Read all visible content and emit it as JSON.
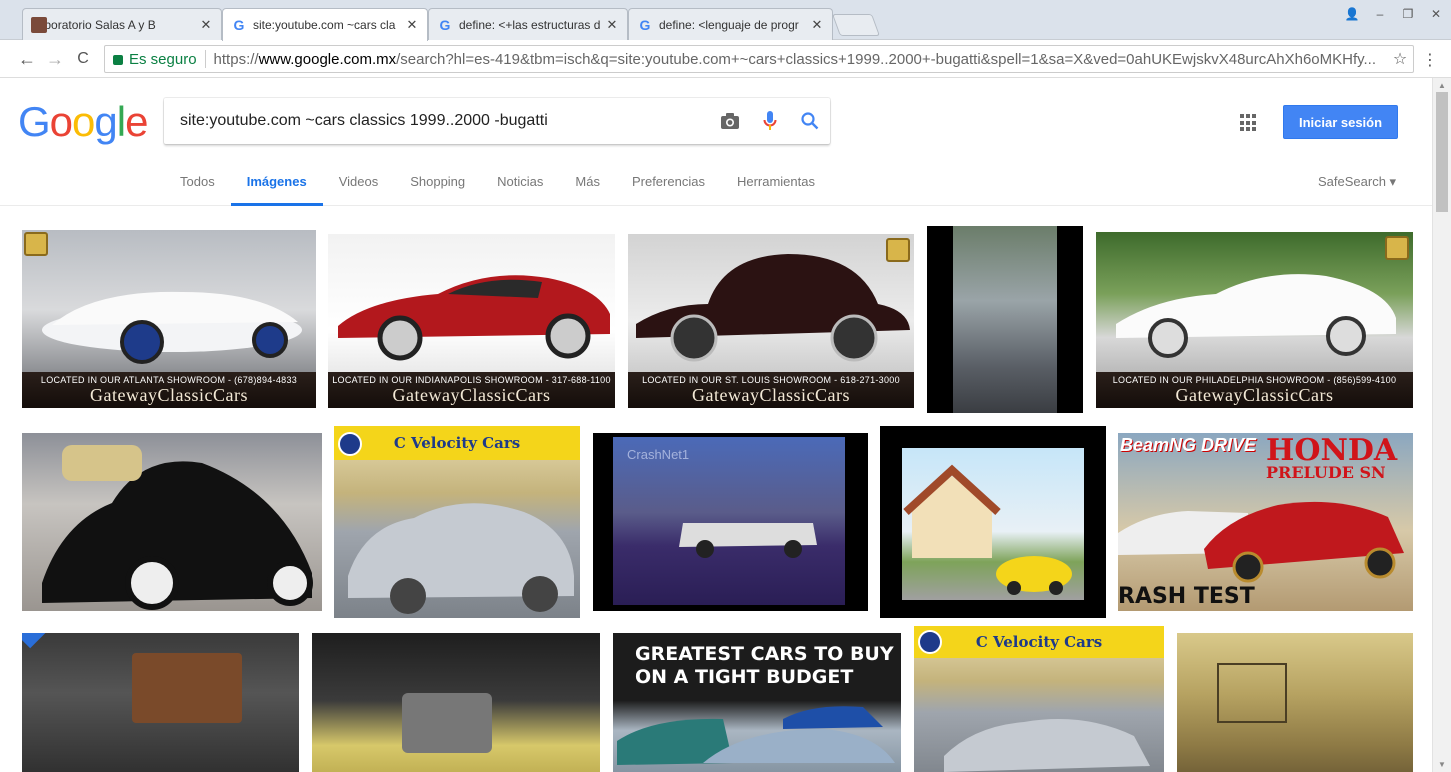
{
  "browser": {
    "tabs": [
      {
        "title": "Laboratorio Salas A y B",
        "favicon": "lab-image-icon"
      },
      {
        "title": "site:youtube.com ~cars cla",
        "favicon": "google-icon",
        "active": true
      },
      {
        "title": "define: <+las estructuras d",
        "favicon": "google-icon"
      },
      {
        "title": "define: <lenguaje de progr",
        "favicon": "google-icon"
      }
    ],
    "close_glyph": "✕",
    "window_controls": {
      "profile": "👤",
      "minimize": "–",
      "maximize": "❐",
      "close": "✕"
    },
    "nav": {
      "back": "←",
      "forward": "→",
      "reload": "C"
    },
    "secure_label": "Es seguro",
    "url_scheme": "https://",
    "url_host": "www.google.com.mx",
    "url_rest": "/search?hl=es-419&tbm=isch&q=site:youtube.com+~cars+classics+1999..2000+-bugatti&spell=1&sa=X&ved=0ahUKEwjskvX48urcAhXh6oMKHfy...",
    "star": "☆",
    "menu": "⋮"
  },
  "google": {
    "logo_letters": [
      "G",
      "o",
      "o",
      "g",
      "l",
      "e"
    ],
    "query": "site:youtube.com ~cars classics 1999..2000 -bugatti",
    "signin": "Iniciar sesión",
    "tabs": [
      "Todos",
      "Imágenes",
      "Videos",
      "Shopping",
      "Noticias",
      "Más",
      "Preferencias",
      "Herramientas"
    ],
    "active_tab": "Imágenes",
    "safesearch": "SafeSearch ▾"
  },
  "images": {
    "gateway_brand": "GatewayClassicCars",
    "located": "LOCATED IN OUR",
    "gateway_captions": [
      "ATLANTA SHOWROOM - (678)894-4833",
      "INDIANAPOLIS SHOWROOM - 317-688-1100",
      "ST. LOUIS SHOWROOM - 618-271-3000",
      "PHILADELPHIA SHOWROOM - (856)599-4100"
    ],
    "velocity": "C Velocity Cars",
    "crashnet": "CrashNet1",
    "beamng_left": "BeamNG DRIVE",
    "honda_title": "HONDA",
    "honda_sub": "PRELUDE SN",
    "crash_test": "RASH TEST",
    "budget_headline": "GREATEST CARS TO BUY ON A TIGHT BUDGET"
  }
}
